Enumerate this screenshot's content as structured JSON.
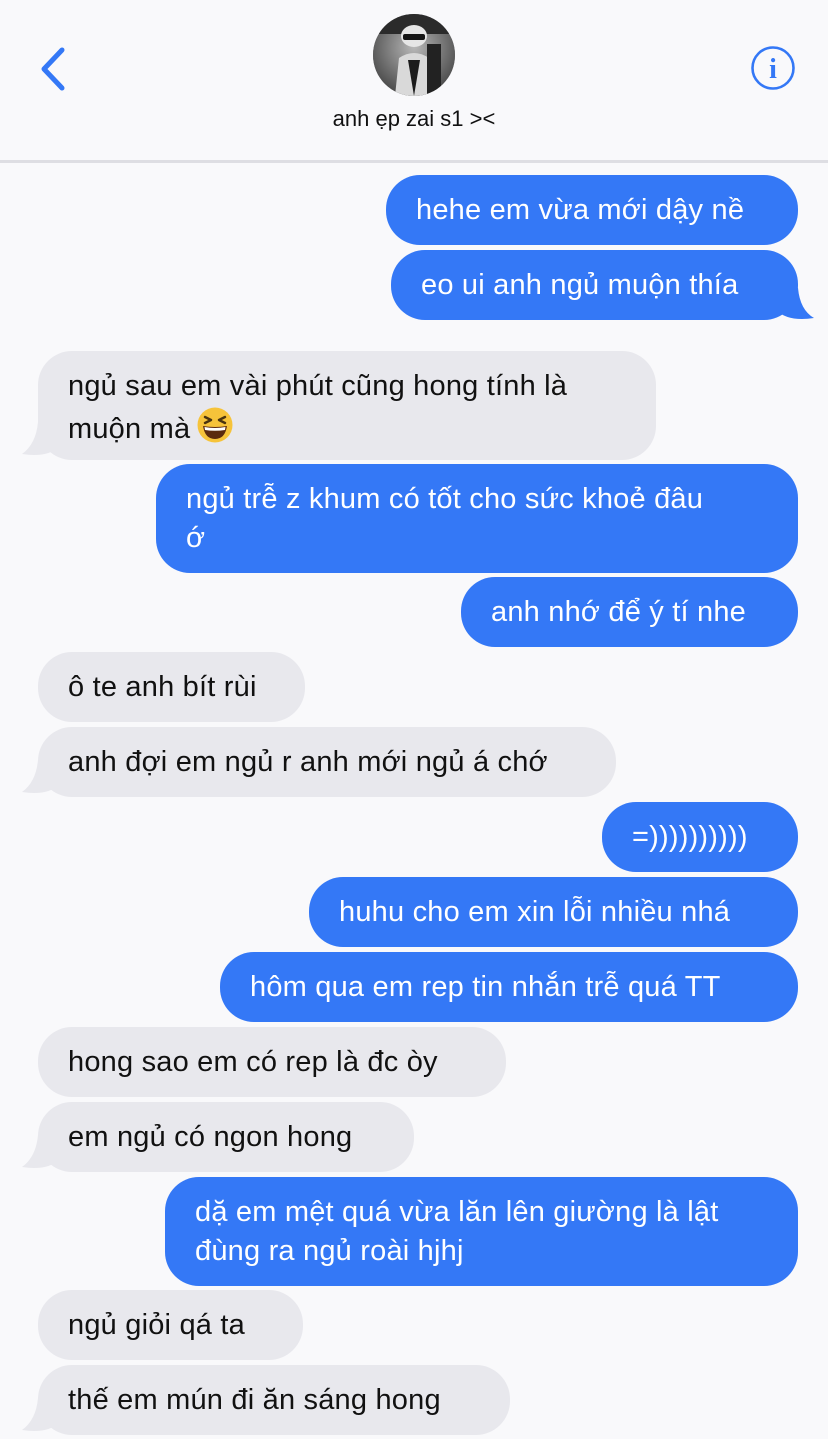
{
  "header": {
    "contact_name": "anh ẹp zai s1 ><",
    "back_icon": "chevron-left-icon",
    "info_icon": "info-circle-icon",
    "accent_color": "#3478f6"
  },
  "colors": {
    "sent_bubble": "#3478f6",
    "received_bubble": "#e8e8ed",
    "background": "#f9f9fb"
  },
  "messages": [
    {
      "from": "me",
      "text": "hehe em vừa mới dậy nề"
    },
    {
      "from": "me",
      "text": "eo ui anh ngủ muộn thía"
    },
    {
      "from": "them",
      "text": "ngủ sau em vài phút cũng hong tính là\nmuộn mà",
      "emoji": "grinning-squinting-face"
    },
    {
      "from": "me",
      "text": "ngủ trễ z khum có tốt cho sức khoẻ đâu\nớ"
    },
    {
      "from": "me",
      "text": "anh nhớ để ý tí nhe"
    },
    {
      "from": "them",
      "text": "ô te anh bít rùi"
    },
    {
      "from": "them",
      "text": "anh đợi em ngủ r anh mới ngủ á chớ"
    },
    {
      "from": "me",
      "text": "=))))))))))"
    },
    {
      "from": "me",
      "text": "huhu cho em xin lỗi nhiều nhá"
    },
    {
      "from": "me",
      "text": "hôm qua em rep tin nhắn trễ quá TT"
    },
    {
      "from": "them",
      "text": "hong sao em có rep là đc òy"
    },
    {
      "from": "them",
      "text": "em ngủ có ngon hong"
    },
    {
      "from": "me",
      "text": "dặ em mệt quá vừa lăn lên giường là lật\nđùng ra ngủ roài hjhj"
    },
    {
      "from": "them",
      "text": "ngủ giỏi qá ta"
    },
    {
      "from": "them",
      "text": "thế em mún đi ăn sáng hong"
    }
  ]
}
